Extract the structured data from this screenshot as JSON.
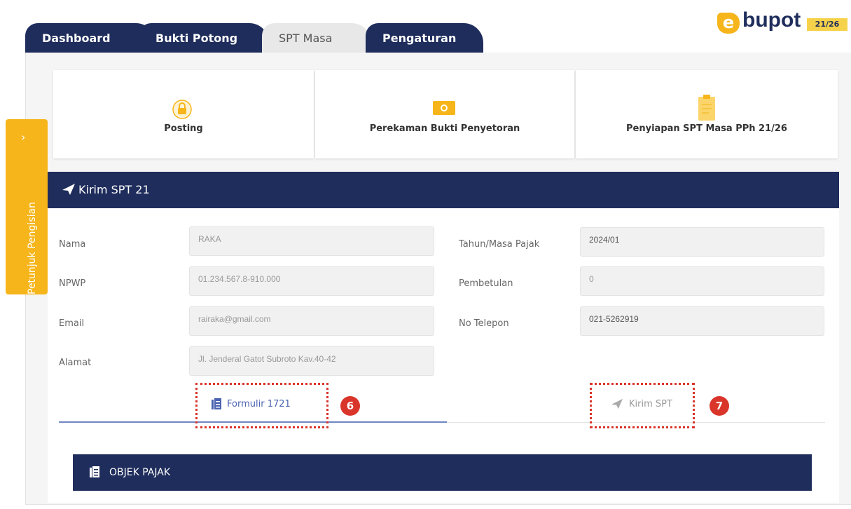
{
  "tabs": [
    {
      "label": "Dashboard"
    },
    {
      "label": "Bukti Potong"
    },
    {
      "label": "SPT Masa"
    },
    {
      "label": "Pengaturan"
    }
  ],
  "logo": {
    "text": "bupot",
    "badge": "21/26"
  },
  "steps": [
    {
      "label": "Posting",
      "icon": "lock-icon"
    },
    {
      "label": "Perekaman Bukti Penyetoran",
      "icon": "camera-icon"
    },
    {
      "label": "Penyiapan SPT Masa PPh 21/26",
      "icon": "clipboard-icon"
    }
  ],
  "side_tab": {
    "label": "Petunjuk Pengisian",
    "icon": "chevron-right-icon"
  },
  "section": {
    "title": "Kirim SPT 21",
    "icon": "send-icon"
  },
  "form": {
    "nama_label": "Nama",
    "nama_value": "RAKA",
    "npwp_label": "NPWP",
    "npwp_value": "01.234.567.8-910.000",
    "email_label": "Email",
    "email_value": "rairaka@gmail.com",
    "alamat_label": "Alamat",
    "alamat_value": "Jl. Jenderal Gatot Subroto Kav.40-42",
    "tahun_label": "Tahun/Masa Pajak",
    "tahun_value": "2024/01",
    "pembetulan_label": "Pembetulan",
    "pembetulan_value": "0",
    "telepon_label": "No Telepon",
    "telepon_value": "021-5262919"
  },
  "actions": {
    "formulir_label": "Formulir 1721",
    "kirim_label": "Kirim SPT",
    "callout_6": "6",
    "callout_7": "7"
  },
  "objek": {
    "title": "OBJEK PAJAK",
    "icon": "document-icon"
  },
  "colors": {
    "navy": "#1f2d5c",
    "accent": "#f6b51a",
    "callout": "#d9352b"
  }
}
